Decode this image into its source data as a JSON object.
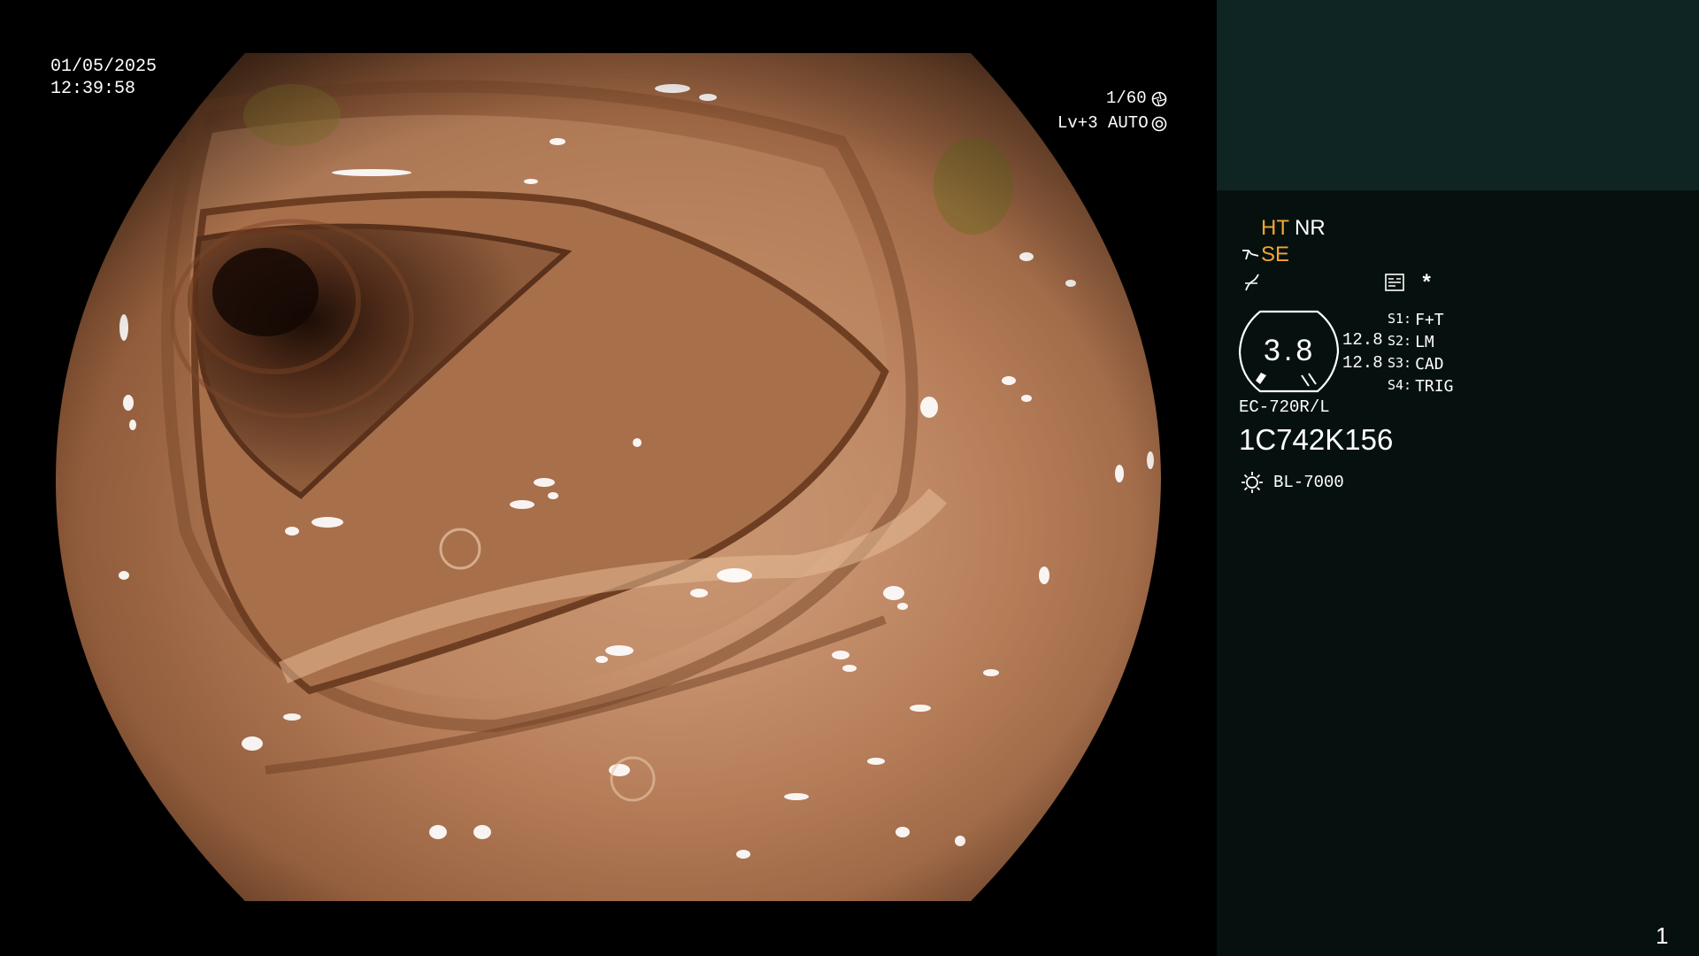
{
  "overlay": {
    "date": "01/05/2025",
    "time": "12:39:58",
    "shutter": "1/60",
    "level": "Lv+3",
    "mode": "AUTO"
  },
  "panel": {
    "ht_label": "HT",
    "nr_label": "NR",
    "se_label": "SE",
    "asterisk": "*",
    "gauge_value": "3.8",
    "gauge_left_1": "12.8",
    "gauge_left_2": "12.8",
    "switches": [
      {
        "key": "S1:",
        "value": "F+T"
      },
      {
        "key": "S2:",
        "value": "LM"
      },
      {
        "key": "S3:",
        "value": "CAD"
      },
      {
        "key": "S4:",
        "value": "TRIG"
      }
    ],
    "scope_model": "EC-720R/L",
    "serial": "1C742K156",
    "light_source": "BL-7000",
    "page_number": "1"
  },
  "colors": {
    "accent_orange": "#f2a531",
    "panel_bg": "#06110f",
    "panel_top_bg": "#0f2523"
  },
  "icons": [
    "shutter-icon",
    "auto-iris-icon",
    "se-scope-icon",
    "gamma-icon",
    "settings-card-icon",
    "light-source-icon"
  ]
}
